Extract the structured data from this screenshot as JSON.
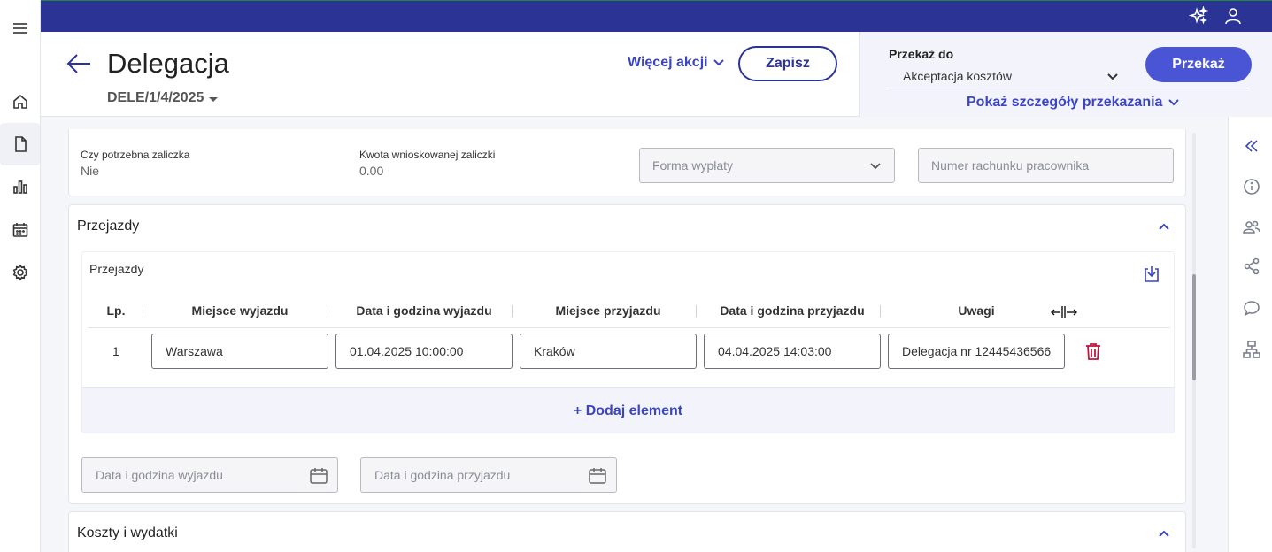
{
  "header": {
    "title": "Delegacja",
    "doc_number": "DELE/1/4/2025",
    "more_actions": "Więcej akcji",
    "save": "Zapisz"
  },
  "transfer": {
    "label": "Przekaż do",
    "selected": "Akceptacja kosztów",
    "button": "Przekaż",
    "details_link": "Pokaż szczegóły przekazania"
  },
  "advance": {
    "needed_label": "Czy potrzebna zaliczka",
    "needed_value": "Nie",
    "amount_label": "Kwota wnioskowanej zaliczki",
    "amount_value": "0.00",
    "payment_form_placeholder": "Forma wypłaty",
    "account_placeholder": "Numer rachunku pracownika"
  },
  "trips": {
    "section_title": "Przejazdy",
    "table_title": "Przejazdy",
    "columns": [
      "Lp.",
      "Miejsce wyjazdu",
      "Data i godzina wyjazdu",
      "Miejsce przyjazdu",
      "Data i godzina przyjazdu",
      "Uwagi"
    ],
    "rows": [
      {
        "lp": "1",
        "departure_place": "Warszawa",
        "departure_datetime": "01.04.2025 10:00:00",
        "arrival_place": "Kraków",
        "arrival_datetime": "04.04.2025 14:03:00",
        "notes": "Delegacja nr 12445436566"
      }
    ],
    "add_element": "+ Dodaj element",
    "departure_filter_placeholder": "Data i godzina wyjazdu",
    "arrival_filter_placeholder": "Data i godzina przyjazdu"
  },
  "costs": {
    "section_title": "Koszty i wydatki"
  },
  "icons": {
    "menu": "menu-icon",
    "home": "home-icon",
    "document": "document-icon",
    "chart": "bar-chart-icon",
    "calendar": "calendar-icon",
    "settings": "gear-icon",
    "ai": "sparkles-icon",
    "user": "user-icon"
  },
  "colors": {
    "topbar": "#2b3494",
    "accent": "#3a44c4",
    "primary_button": "#4a55d6",
    "delete": "#c0163d"
  }
}
